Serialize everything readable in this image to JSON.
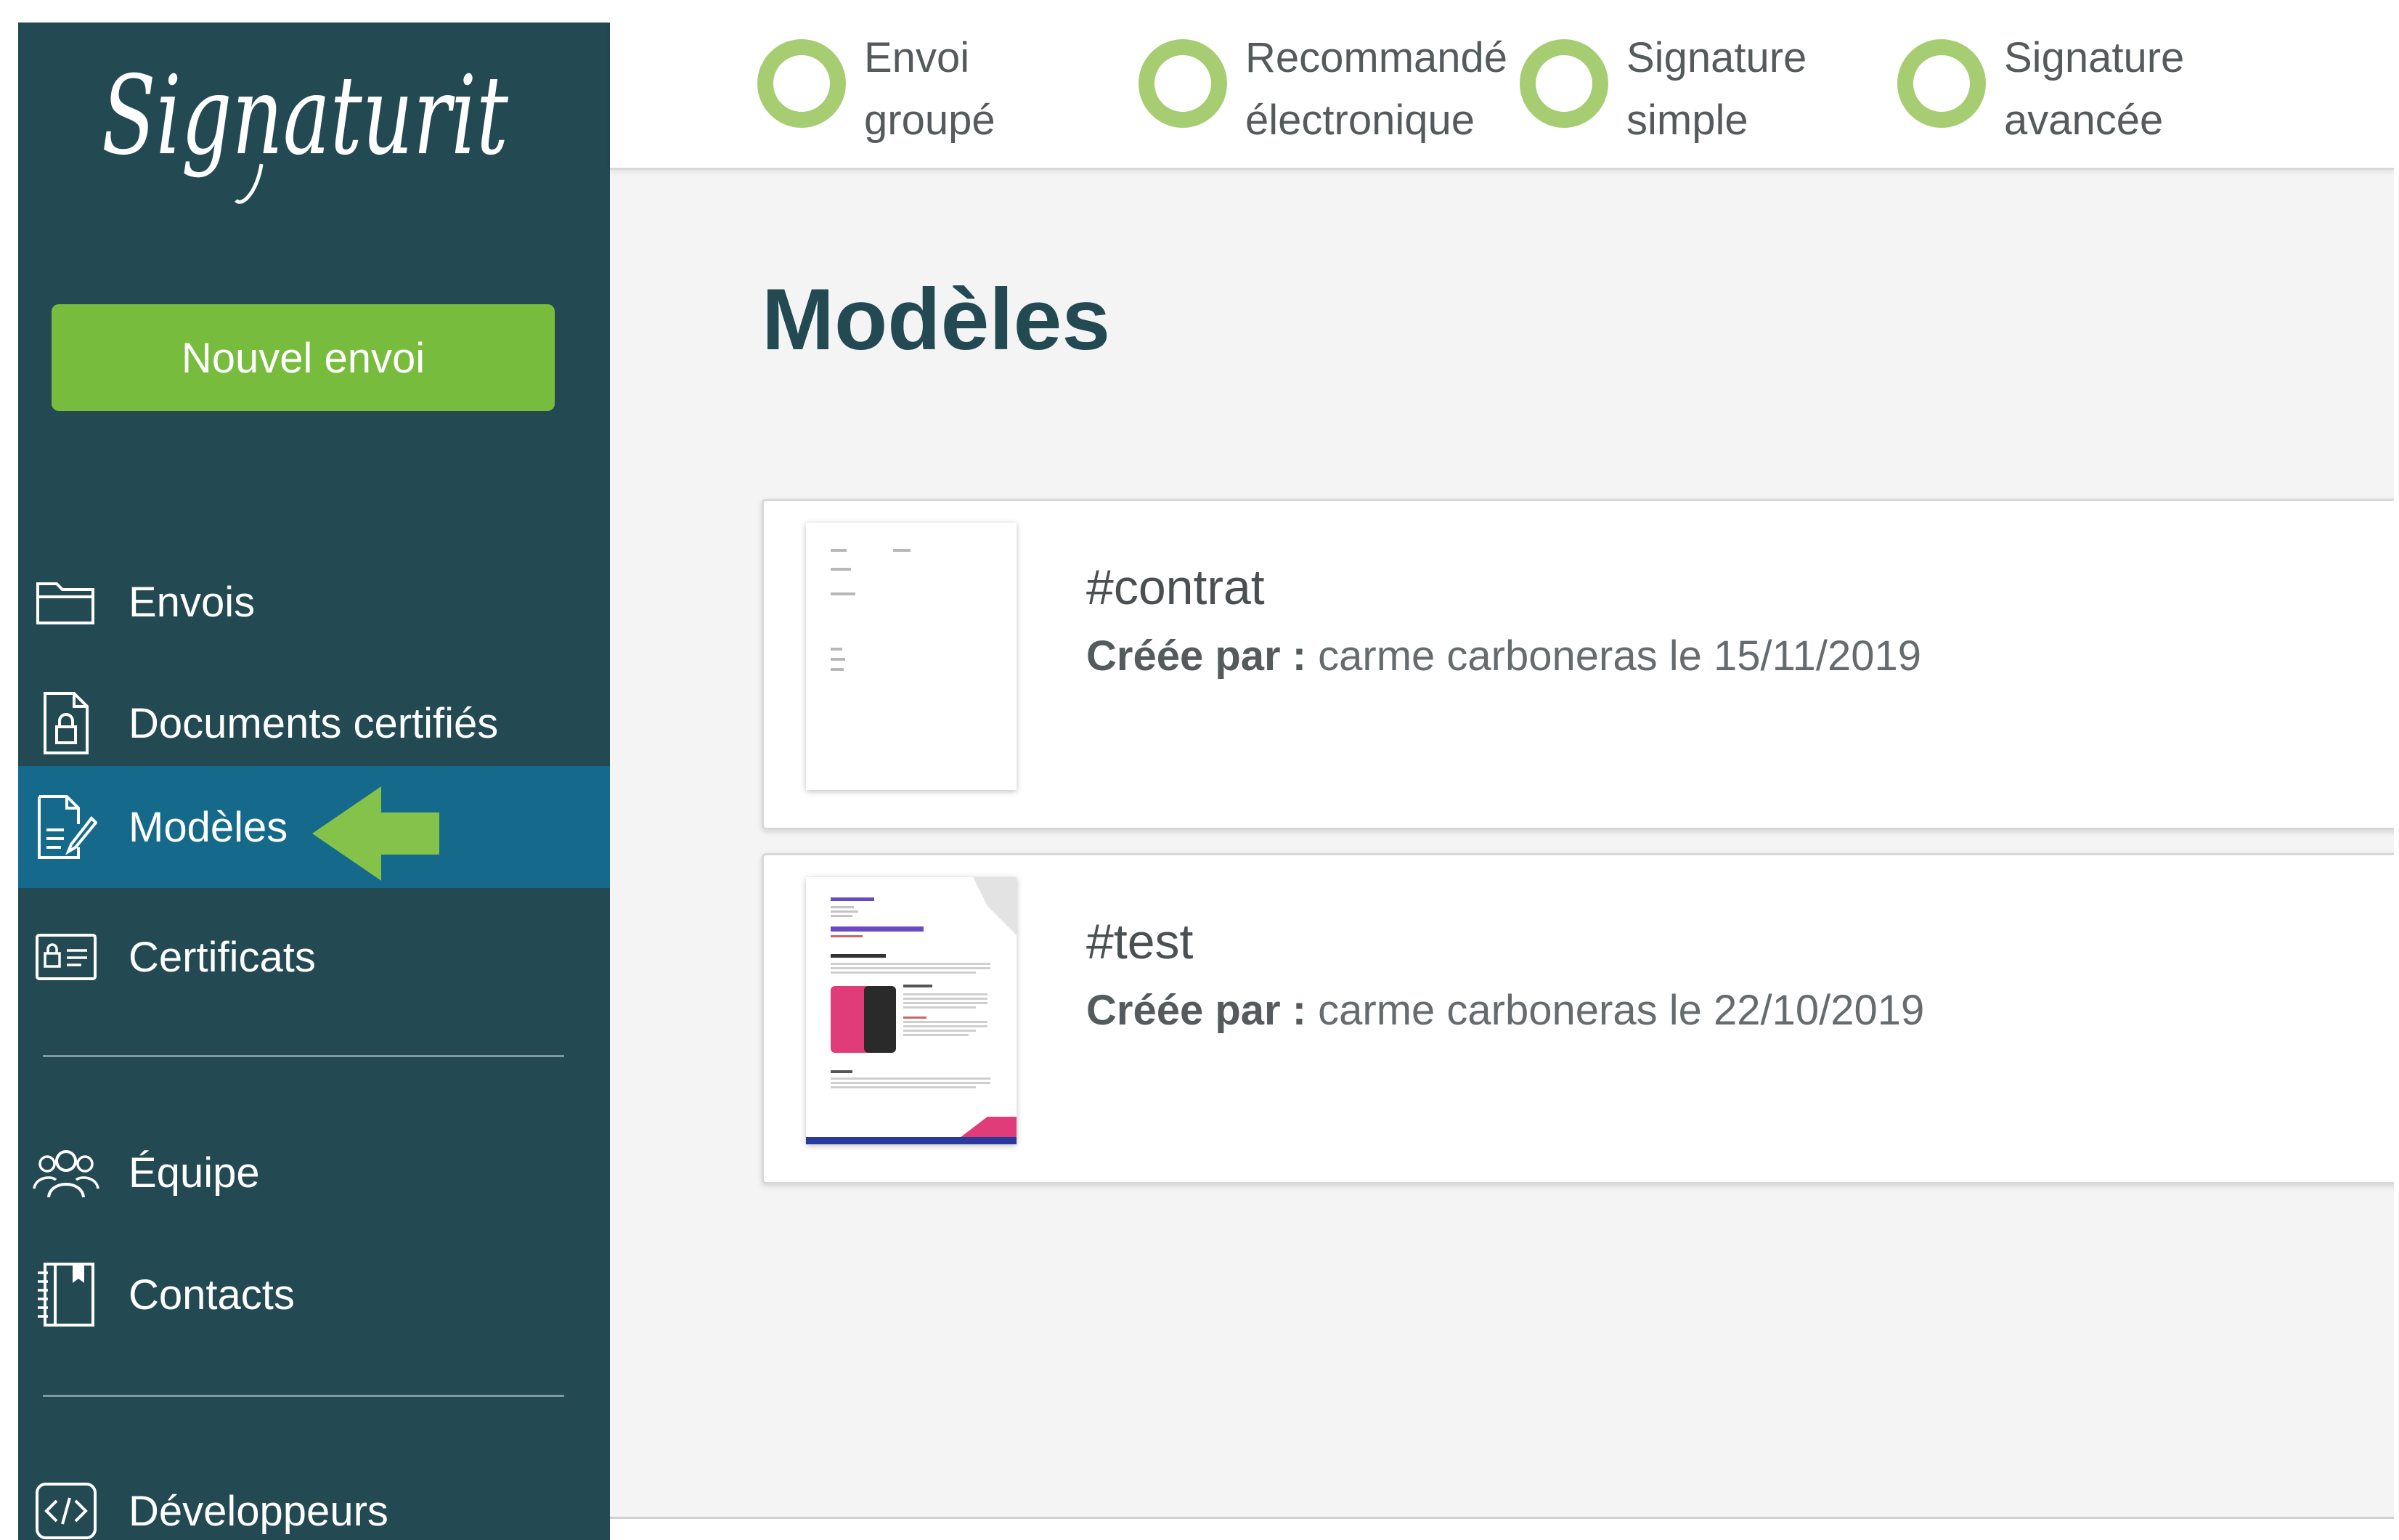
{
  "brand": {
    "logo_text": "Signaturit",
    "sidebar_color": "#234953",
    "active_color": "#156a8c",
    "accent_green": "#78bc3d",
    "title_color": "#234953"
  },
  "sidebar": {
    "new_button_label": "Nouvel envoi",
    "items": [
      {
        "label": "Envois",
        "icon": "folder-icon"
      },
      {
        "label": "Documents certifiés",
        "icon": "locked-document-icon"
      },
      {
        "label": "Modèles",
        "icon": "template-icon",
        "active": true
      },
      {
        "label": "Certificats",
        "icon": "certificate-card-icon"
      },
      {
        "label": "Équipe",
        "icon": "team-icon"
      },
      {
        "label": "Contacts",
        "icon": "address-book-icon"
      },
      {
        "label": "Développeurs",
        "icon": "code-icon"
      }
    ]
  },
  "topbar": {
    "steps": [
      {
        "line1": "Envoi",
        "line2": "groupé"
      },
      {
        "line1": "Recommandé",
        "line2": "électronique"
      },
      {
        "line1": "Signature",
        "line2": "simple"
      },
      {
        "line1": "Signature",
        "line2": "avancée"
      }
    ]
  },
  "main": {
    "title": "Modèles",
    "templates": [
      {
        "name": "#contrat",
        "created_by_label": "Créée par :",
        "author": "carme carboneras",
        "date_prefix": "le",
        "date": "15/11/2019"
      },
      {
        "name": "#test",
        "created_by_label": "Créée par :",
        "author": "carme carboneras",
        "date_prefix": "le",
        "date": "22/10/2019"
      }
    ]
  }
}
